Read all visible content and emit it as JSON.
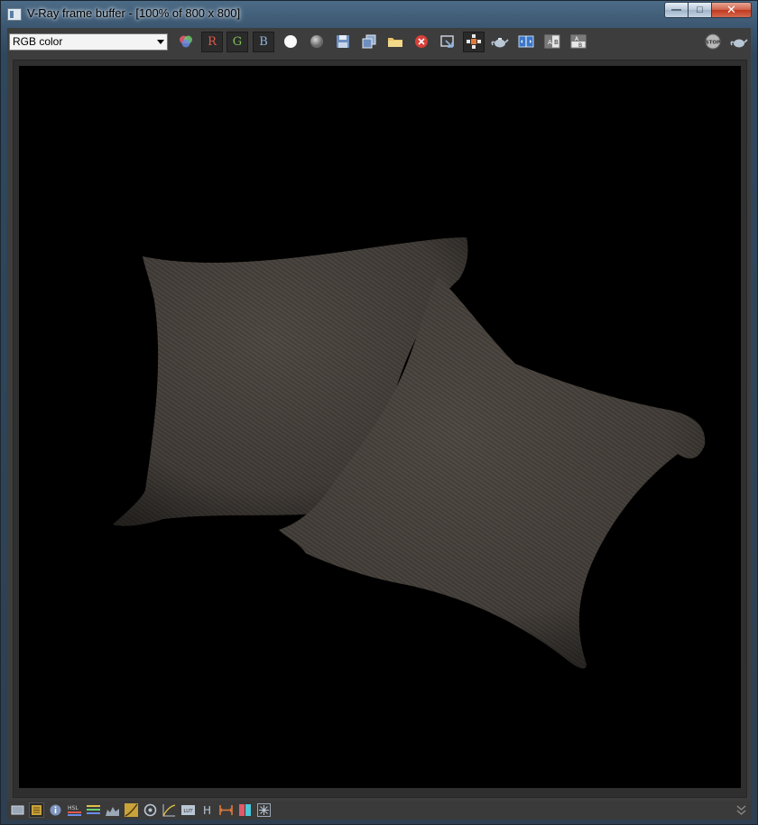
{
  "window": {
    "title": "V-Ray frame buffer - [100% of 800 x 800]",
    "controls": {
      "minimize": "—",
      "maximize": "□",
      "close": "✕"
    }
  },
  "toolbar": {
    "channel_select": {
      "value": "RGB color"
    },
    "channels": {
      "red": "R",
      "green": "G",
      "blue": "B"
    },
    "icons": [
      "color-wheel-icon",
      "white-sphere-icon",
      "gray-sphere-icon",
      "save-icon",
      "copy-icon",
      "folder-icon",
      "clear-icon",
      "region-icon",
      "follow-mouse-icon",
      "render-teapot-icon",
      "compare-icon",
      "ab-horizontal-icon",
      "ab-vertical-icon",
      "stop-icon",
      "render-last-icon"
    ],
    "stop_label": "STOP"
  },
  "status": {
    "icons": [
      "display-icon",
      "color-corrections-icon",
      "info-icon",
      "hsl-icon",
      "levels-icon",
      "histogram-icon",
      "curves-icon",
      "lut-icon",
      "ocio-icon",
      "exposure-icon",
      "h-icon",
      "pixel-aspect-icon",
      "split-icon",
      "lens-effects-icon"
    ],
    "hsl_label": "HSL",
    "h_label": "H",
    "lut_label": "LUT"
  },
  "colors": {
    "red": "#e05a4a",
    "green": "#7fbf5a",
    "blue": "#8fb3e0",
    "pillow": "#514b45"
  }
}
